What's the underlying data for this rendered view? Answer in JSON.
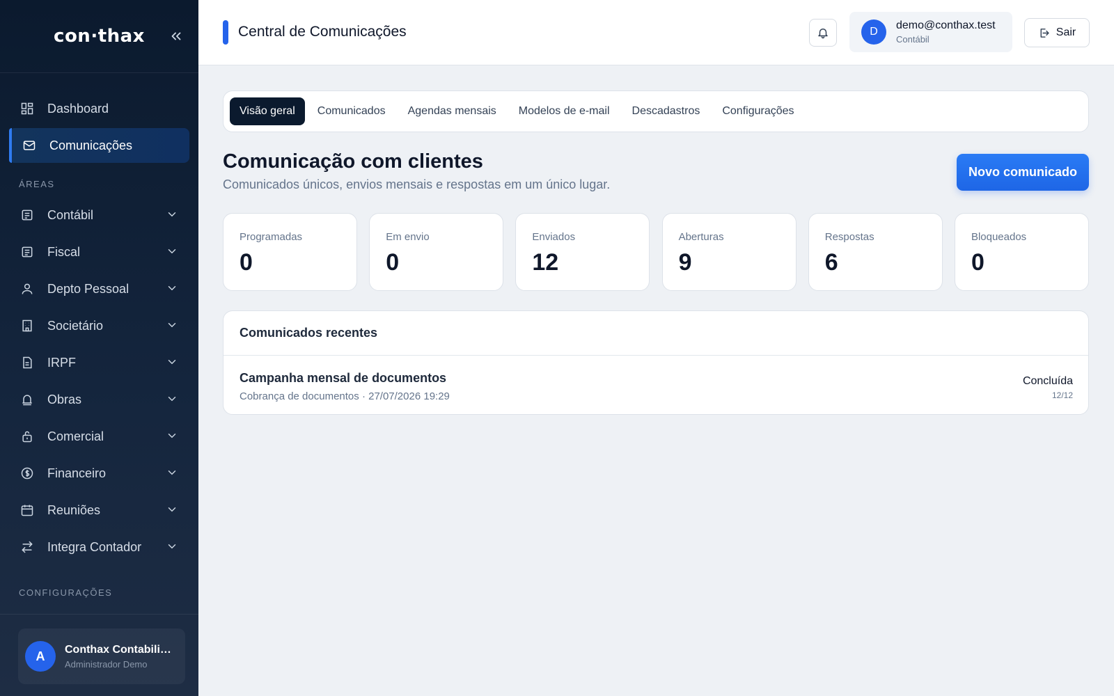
{
  "brand": {
    "logo": "con·thax"
  },
  "sidebar": {
    "items": [
      {
        "label": "Dashboard",
        "icon": "dashboard-icon"
      },
      {
        "label": "Comunicações",
        "icon": "mail-icon",
        "active": true
      }
    ],
    "areas_label": "ÁREAS",
    "areas": [
      {
        "label": "Contábil",
        "icon": "ledger-icon"
      },
      {
        "label": "Fiscal",
        "icon": "receipt-icon"
      },
      {
        "label": "Depto Pessoal",
        "icon": "user-icon"
      },
      {
        "label": "Societário",
        "icon": "building-icon"
      },
      {
        "label": "IRPF",
        "icon": "document-icon"
      },
      {
        "label": "Obras",
        "icon": "construction-icon"
      },
      {
        "label": "Comercial",
        "icon": "briefcase-icon"
      },
      {
        "label": "Financeiro",
        "icon": "dollar-icon"
      },
      {
        "label": "Reuniões",
        "icon": "calendar-icon"
      },
      {
        "label": "Integra Contador",
        "icon": "swap-icon"
      }
    ],
    "config_label": "CONFIGURAÇÕES",
    "user": {
      "initial": "A",
      "name": "Conthax Contabilidade",
      "role": "Administrador Demo"
    }
  },
  "header": {
    "title": "Central de Comunicações",
    "account": {
      "initial": "D",
      "email": "demo@conthax.test",
      "role": "Contábil"
    },
    "logout_label": "Sair"
  },
  "tabs": [
    "Visão geral",
    "Comunicados",
    "Agendas mensais",
    "Modelos de e-mail",
    "Descadastros",
    "Configurações"
  ],
  "page": {
    "title": "Comunicação com clientes",
    "subtitle": "Comunicados únicos, envios mensais e respostas em um único lugar.",
    "new_button": "Novo comunicado"
  },
  "stats": [
    {
      "label": "Programadas",
      "value": "0"
    },
    {
      "label": "Em envio",
      "value": "0"
    },
    {
      "label": "Enviados",
      "value": "12"
    },
    {
      "label": "Aberturas",
      "value": "9"
    },
    {
      "label": "Respostas",
      "value": "6"
    },
    {
      "label": "Bloqueados",
      "value": "0"
    }
  ],
  "recent": {
    "title": "Comunicados recentes",
    "rows": [
      {
        "title": "Campanha mensal de documentos",
        "meta": "Cobrança de documentos · 27/07/2026 19:29",
        "status": "Concluída",
        "count": "12/12"
      }
    ]
  },
  "colors": {
    "accent": "#2563eb",
    "sidebar_bg": "#0b1a2e",
    "active_tab": "#0b1a2e"
  }
}
